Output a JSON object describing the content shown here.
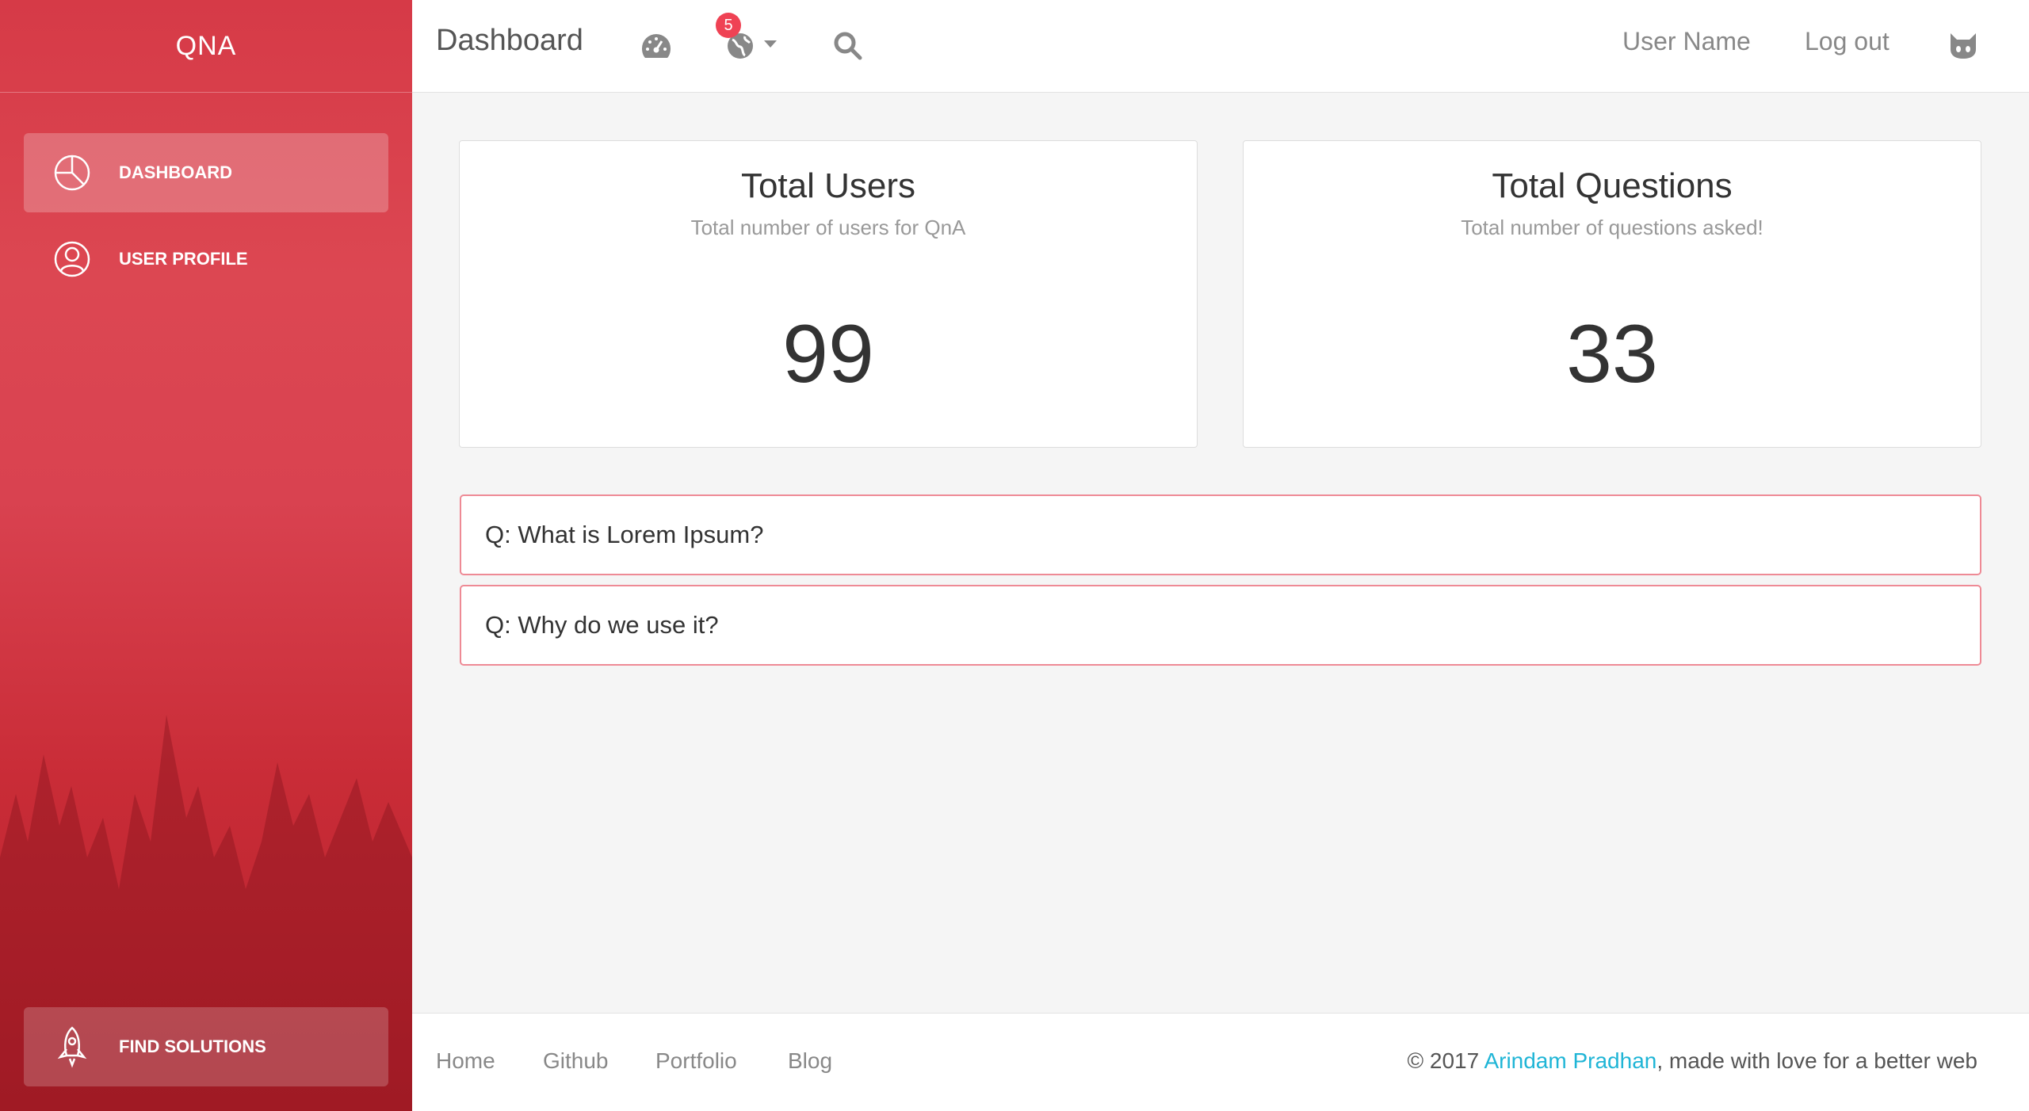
{
  "sidebar": {
    "brand": "QNA",
    "items": [
      {
        "label": "DASHBOARD",
        "icon": "pie-chart-icon",
        "active": true
      },
      {
        "label": "USER PROFILE",
        "icon": "user-circle-icon",
        "active": false
      }
    ],
    "bottom_action": {
      "label": "FIND SOLUTIONS",
      "icon": "rocket-icon"
    }
  },
  "topbar": {
    "title": "Dashboard",
    "icons": [
      "dashboard-gauge-icon",
      "globe-icon",
      "search-icon",
      "github-icon"
    ],
    "notification_count": "5",
    "user_name": "User Name",
    "logout": "Log out"
  },
  "stats": [
    {
      "title": "Total Users",
      "subtitle": "Total number of users for QnA",
      "value": "99"
    },
    {
      "title": "Total Questions",
      "subtitle": "Total number of questions asked!",
      "value": "33"
    }
  ],
  "questions": [
    {
      "text": "Q: What is Lorem Ipsum?"
    },
    {
      "text": "Q: Why do we use it?"
    }
  ],
  "footer": {
    "links": [
      "Home",
      "Github",
      "Portfolio",
      "Blog"
    ],
    "copyright_prefix": "© 2017 ",
    "author": "Arindam Pradhan",
    "copyright_suffix": ", made with love for a better web"
  },
  "colors": {
    "sidebar_red": "#d94250",
    "accent_badge": "#ef4254",
    "question_border": "#ee8a95",
    "author_link": "#1fb5d6"
  }
}
